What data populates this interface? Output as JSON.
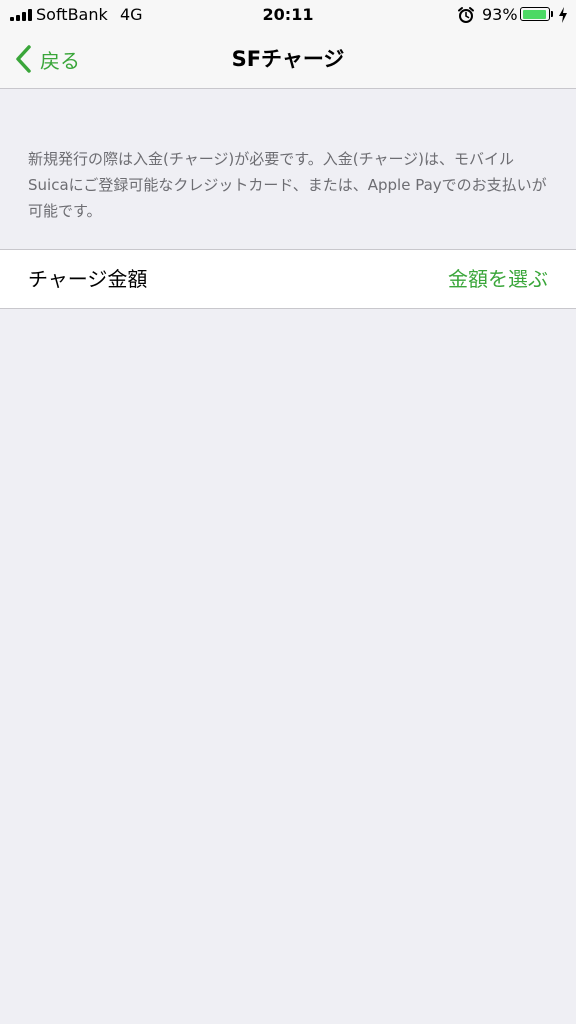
{
  "status_bar": {
    "carrier": "SoftBank",
    "network": "4G",
    "time": "20:11",
    "battery_percent": "93%",
    "battery_level": 0.93,
    "alarm_icon": "alarm-icon",
    "charging_icon": "bolt-icon"
  },
  "nav": {
    "back_label": "戻る",
    "title": "SFチャージ"
  },
  "description": "新規発行の際は入金(チャージ)が必要です。入金(チャージ)は、モバイルSuicaにご登録可能なクレジットカード、または、Apple Payでのお支払いが可能です。",
  "charge_row": {
    "label": "チャージ金額",
    "action": "金額を選ぶ"
  },
  "colors": {
    "accent": "#3aa63a",
    "background": "#efeff4",
    "battery": "#4cd964"
  }
}
